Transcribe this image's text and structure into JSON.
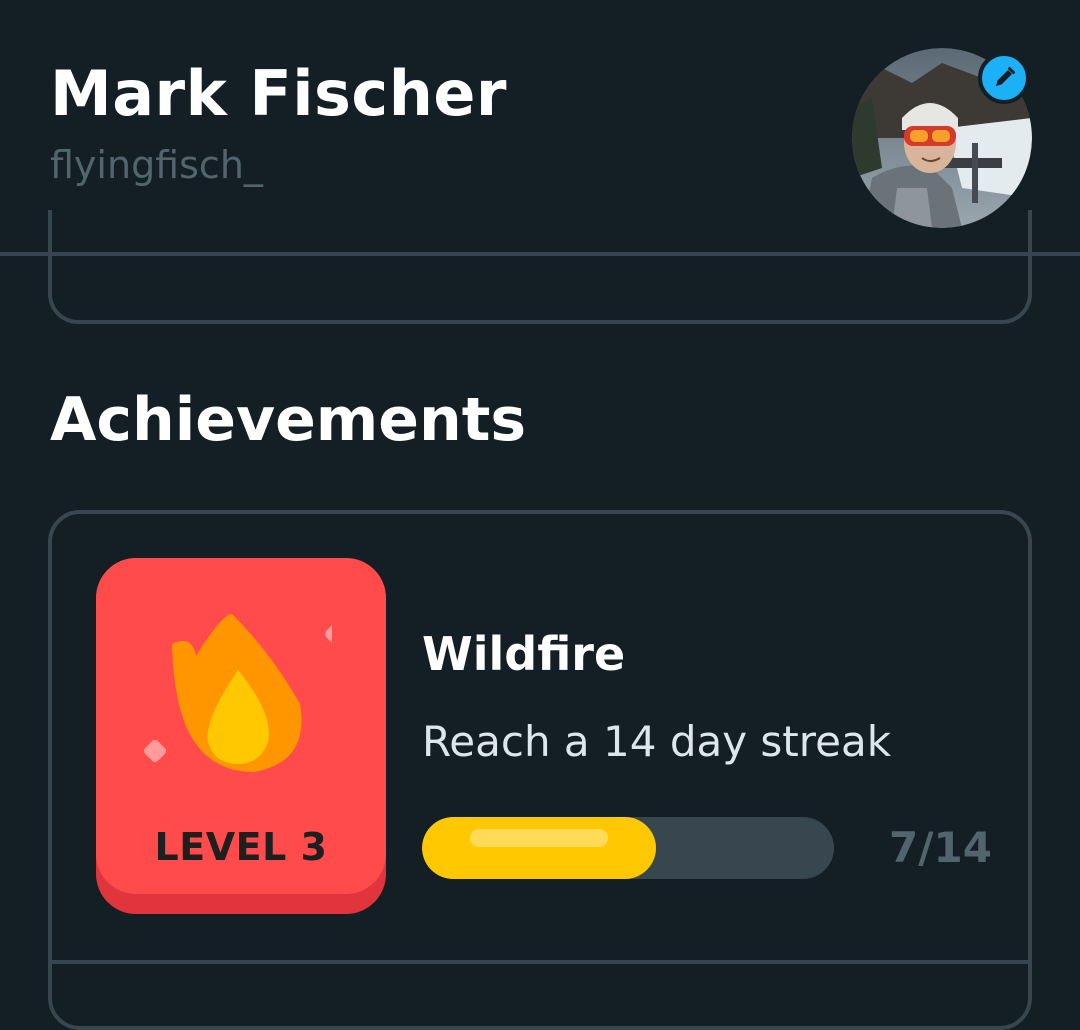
{
  "profile": {
    "name": "Mark Fischer",
    "username": "flyingfisch_",
    "avatar_icon": "user-photo",
    "edit_icon": "pencil-icon"
  },
  "achievements": {
    "heading": "Achievements",
    "items": [
      {
        "title": "Wildfire",
        "description": "Reach a 14 day streak",
        "level_label": "LEVEL 3",
        "progress_current": 7,
        "progress_total": 14,
        "progress_text": "7/14",
        "progress_fraction": 0.5,
        "icon": "flame-icon"
      }
    ]
  },
  "colors": {
    "background": "#131f24",
    "border": "#37464f",
    "badge_red": "#ff4b4b",
    "progress_yellow": "#ffc800",
    "edit_blue": "#1cb0f6",
    "muted_text": "#52656d"
  }
}
